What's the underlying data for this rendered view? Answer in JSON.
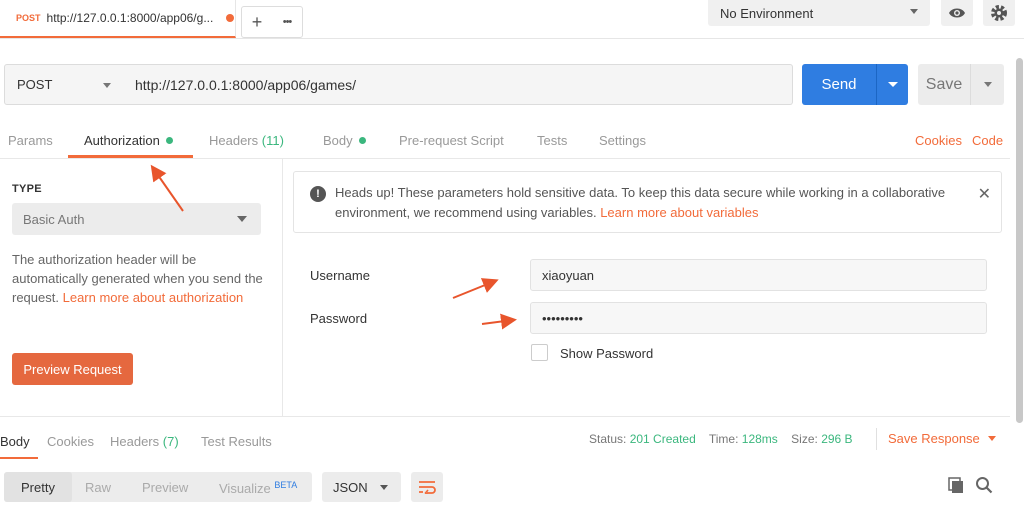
{
  "tab": {
    "method": "POST",
    "url": "http://127.0.0.1:8000/app06/g..."
  },
  "toolbar": {
    "new_tab": "+",
    "more": "•••"
  },
  "environment": {
    "selected": "No Environment"
  },
  "request": {
    "method": "POST",
    "url": "http://127.0.0.1:8000/app06/games/",
    "send_label": "Send",
    "save_label": "Save"
  },
  "request_tabs": {
    "params": "Params",
    "authorization": "Authorization",
    "headers": "Headers",
    "headers_count": "(11)",
    "body": "Body",
    "prerequest": "Pre-request Script",
    "tests": "Tests",
    "settings": "Settings",
    "cookies": "Cookies",
    "code": "Code"
  },
  "auth": {
    "type_label": "TYPE",
    "type_value": "Basic Auth",
    "description": "The authorization header will be automatically generated when you send the request.",
    "learn_more": "Learn more about authorization",
    "preview_button": "Preview Request"
  },
  "notice": {
    "text": "Heads up! These parameters hold sensitive data. To keep this data secure while working in a collaborative environment, we recommend using variables.",
    "link": "Learn more about variables"
  },
  "fields": {
    "username_label": "Username",
    "username_value": "xiaoyuan",
    "password_label": "Password",
    "password_value": "•••••••••",
    "show_password": "Show Password"
  },
  "response_tabs": {
    "body": "Body",
    "cookies": "Cookies",
    "headers": "Headers",
    "headers_count": "(7)",
    "test_results": "Test Results"
  },
  "response_status": {
    "status_label": "Status:",
    "status_value": "201 Created",
    "time_label": "Time:",
    "time_value": "128ms",
    "size_label": "Size:",
    "size_value": "296 B",
    "save_response": "Save Response"
  },
  "response_view": {
    "pretty": "Pretty",
    "raw": "Raw",
    "preview": "Preview",
    "visualize": "Visualize",
    "beta": "BETA",
    "format": "JSON"
  },
  "colors": {
    "accent": "#f26b3a",
    "send": "#2f7de1",
    "success": "#3bb77e"
  },
  "icons": [
    "eye-icon",
    "gear-icon",
    "warning-icon",
    "close-icon",
    "wrap-icon",
    "copy-icon",
    "search-icon"
  ]
}
